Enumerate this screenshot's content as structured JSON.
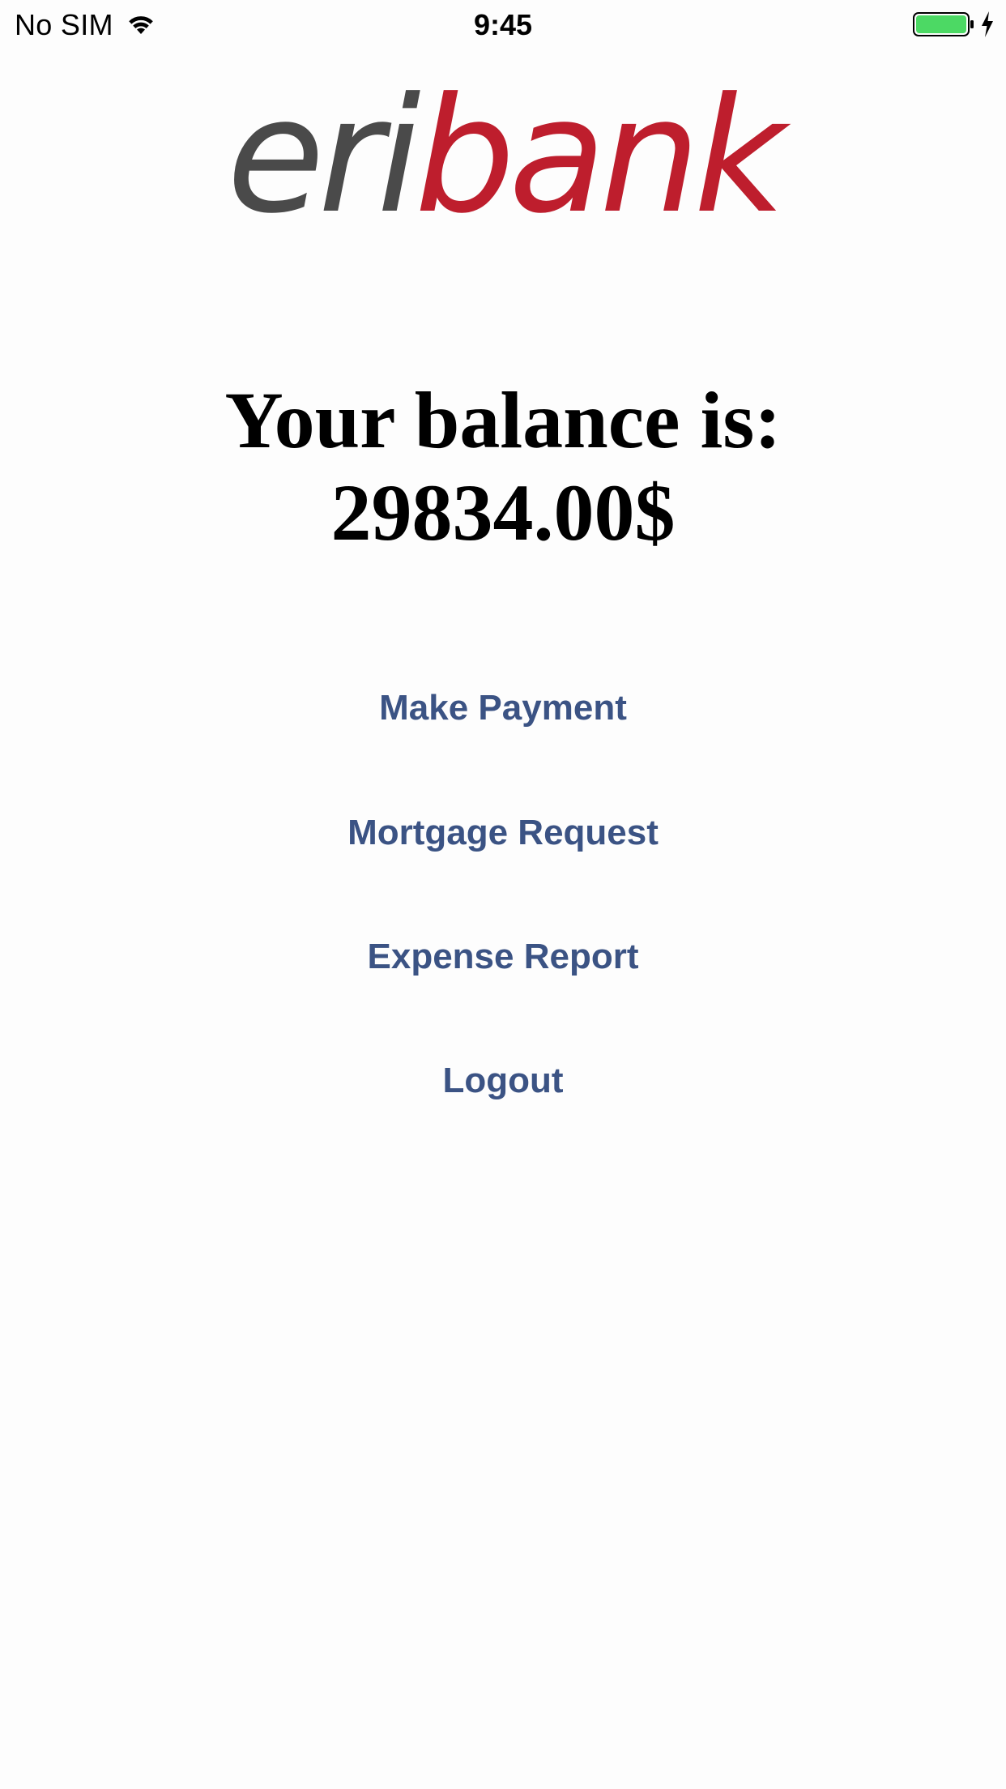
{
  "status_bar": {
    "carrier": "No SIM",
    "time": "9:45",
    "wifi_icon": "wifi-icon",
    "battery_icon": "battery-charging-icon",
    "battery_color": "#4cd964"
  },
  "logo": {
    "part1": "eri",
    "part2": "bank",
    "color_part1": "#4a4a4a",
    "color_part2": "#be1e2d"
  },
  "balance": {
    "label": "Your balance is:",
    "amount": "29834.00$"
  },
  "menu": {
    "make_payment": "Make Payment",
    "mortgage_request": "Mortgage Request",
    "expense_report": "Expense Report",
    "logout": "Logout",
    "link_color": "#3b5384"
  }
}
